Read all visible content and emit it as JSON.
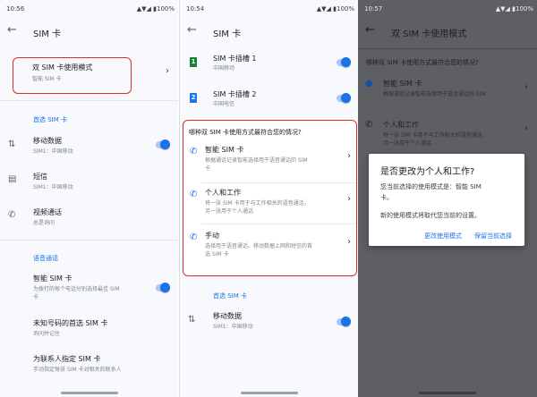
{
  "colors": {
    "accent": "#1a73e8",
    "highlight": "#d93025",
    "sim1": "#188038",
    "sim2": "#1a73e8"
  },
  "left": {
    "status": {
      "time": "10:56",
      "battery": "100%"
    },
    "title": "SIM 卡",
    "dual_mode": {
      "title": "双 SIM 卡使用模式",
      "subtitle": "智能 SIM 卡"
    },
    "preferred_header": "首选 SIM 卡",
    "mobile_data": {
      "title": "移动数据",
      "subtitle": "SIM1：中国移动",
      "toggle": true
    },
    "sms": {
      "title": "短信",
      "subtitle": "SIM1：中国移动"
    },
    "video_call": {
      "title": "视频通话",
      "subtitle": "总是询问"
    },
    "voice_header": "语音通话",
    "smart_sim": {
      "title": "智能 SIM 卡",
      "line1": "为拨打的每个电话分别选择最佳 SIM",
      "line2": "卡",
      "toggle": true
    },
    "unknown": {
      "title": "未知号码的首选 SIM 卡",
      "subtitle": "询问并记住"
    },
    "contacts": {
      "title": "为联系人指定 SIM 卡",
      "subtitle": "手动指定每张 SIM 卡对相关的联系人"
    }
  },
  "middle": {
    "status": {
      "time": "10:54",
      "battery": "100%"
    },
    "title": "SIM 卡",
    "slot1": {
      "badge": "1",
      "title": "SIM 卡插槽 1",
      "subtitle": "中国移动",
      "toggle": true
    },
    "slot2": {
      "badge": "2",
      "title": "SIM 卡插槽 2",
      "subtitle": "中国电信",
      "toggle": true
    },
    "question": "哪种双 SIM 卡使用方式最符合您的情况?",
    "options": [
      {
        "title": "智能 SIM 卡",
        "line1": "根据通话记录智能选择用于语音通话的 SIM",
        "line2": "卡"
      },
      {
        "title": "个人和工作",
        "line1": "将一张 SIM 卡用于与工作相关的语音通话，",
        "line2": "另一张用于个人通话"
      },
      {
        "title": "手动",
        "line1": "选择用于语音通话、移动数据上网和短信的首",
        "line2": "选 SIM 卡"
      }
    ],
    "preferred_header": "首选 SIM 卡",
    "mobile_data": {
      "title": "移动数据",
      "subtitle": "SIM1：中国移动",
      "toggle": true
    }
  },
  "right": {
    "status": {
      "time": "10:57",
      "battery": "100%"
    },
    "title": "双 SIM 卡使用模式",
    "question": "哪种双 SIM 卡使用方式最符合您的情况?",
    "option1": {
      "title": "智能 SIM 卡",
      "subtitle": "根据通话记录智能选择用于语音通话的 SIM"
    },
    "option2": {
      "title": "个人和工作",
      "line1": "将一张 SIM 卡用于与工作相关的语音通话，",
      "line2": "另一张用于个人通话"
    },
    "dialog": {
      "title": "是否更改为个人和工作?",
      "line1": "您当前选择的使用模式是：智能 SIM",
      "line2": "卡。",
      "line3": "新的使用模式将取代您当前的设置。",
      "change": "更改使用模式",
      "keep": "保留当前选择"
    }
  }
}
